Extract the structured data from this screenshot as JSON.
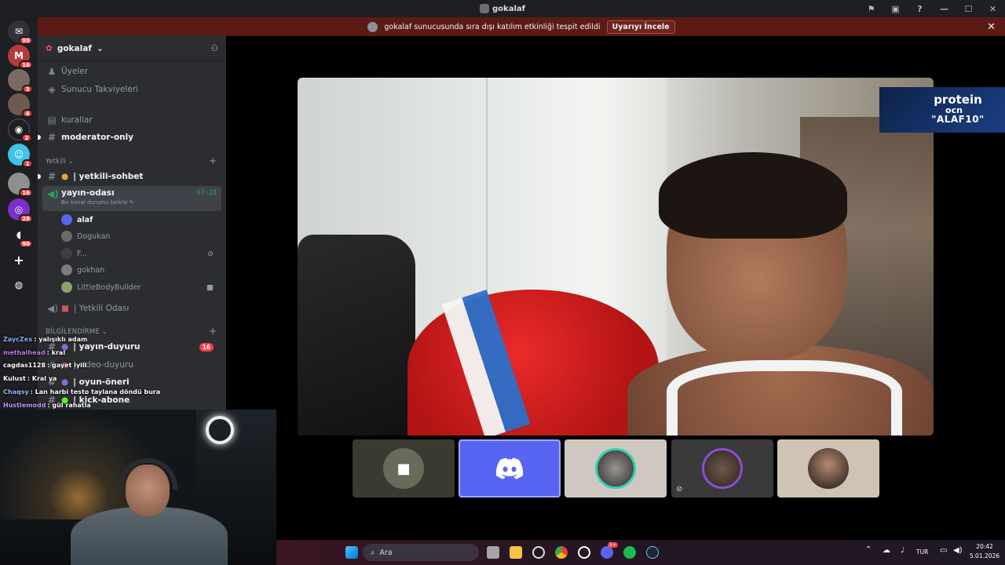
{
  "window": {
    "title": "gokalaf"
  },
  "notice": {
    "text": "gokalaf sunucusunda sıra dışı katılım etkinliği tespit edildi",
    "button": "Uyarıyı İncele"
  },
  "rail": {
    "badges": [
      "99",
      "16",
      "3",
      "4",
      "2",
      "1",
      "16",
      "28",
      "90"
    ]
  },
  "sidebar": {
    "server_name": "gokalaf",
    "top_items": [
      "Üyeler",
      "Sunucu Takviyeleri"
    ],
    "channels_a": [
      "kurallar",
      "moderator-only"
    ],
    "category_yetkili": "Yetkili",
    "yetkili_sohbet": "| yetkili-sohbet",
    "voice_channel": "yayın-odası",
    "voice_timer": "67:28",
    "voice_status": "Bir kanal durumu belirle",
    "voice_users": [
      "alaf",
      "Dogukan",
      "F...",
      "gokhan",
      "LittleBodyBuilder"
    ],
    "yetkili_odasi": "| Yetkili Odası",
    "category_bilgi": "BİLGİLENDİRME",
    "bilgi_channels": [
      "| yayın-duyuru",
      "| video-duyuru",
      "| oyun-öneri",
      "| kick-abone"
    ],
    "yayin_duyuru_badge": "16"
  },
  "chat": [
    {
      "user": "ZaycZex",
      "color": "#7fb2ff",
      "msg": "yalışıklı adam"
    },
    {
      "user": "methalhead",
      "color": "#c27ae8",
      "msg": "kral"
    },
    {
      "user": "cagdas1128",
      "color": "#ffffff",
      "msg": "gayet iyiii"
    },
    {
      "user": "Kulust",
      "color": "#ffffff",
      "msg": "Kral ya"
    },
    {
      "user": "Chaqsy",
      "color": "#9fb7ff",
      "msg": "Lan harbi testo taylana döndü bura"
    },
    {
      "user": "Hustlemodd",
      "color": "#b79cff",
      "msg": "gül rahatla"
    }
  ],
  "ad": {
    "line1": "protein",
    "line2": "ocn",
    "line3": "\"ALAF10\""
  },
  "taskbar": {
    "search_placeholder": "Ara",
    "lang": "TUR",
    "time": "20:42",
    "date": "5.01.2026",
    "discord_badge": "5+"
  },
  "colors": {
    "notice_bg": "#5c1a14",
    "discord_blurple": "#5865f2",
    "badge_red": "#f23f43",
    "voice_green": "#23a55a"
  }
}
